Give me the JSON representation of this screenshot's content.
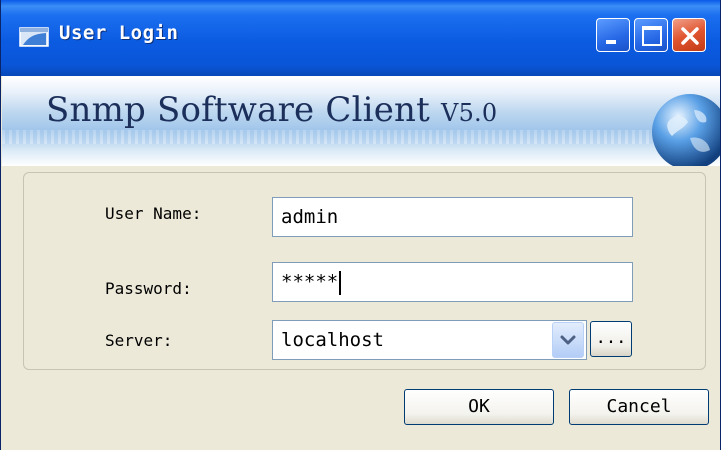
{
  "window": {
    "title": "User Login",
    "app_icon": "login-app-icon",
    "controls": {
      "minimize": "minimize-icon",
      "maximize": "maximize-icon",
      "close": "close-icon"
    }
  },
  "banner": {
    "title": "Snmp Software Client",
    "version": "V5.0",
    "graphic": "globe-icon"
  },
  "form": {
    "username": {
      "label": "User Name:",
      "value": "admin"
    },
    "password": {
      "label": "Password:",
      "value": "*****"
    },
    "server": {
      "label": "Server:",
      "value": "localhost",
      "dropdown_icon": "chevron-down-icon",
      "browse_label": "..."
    }
  },
  "buttons": {
    "ok": "OK",
    "cancel": "Cancel"
  },
  "colors": {
    "titlebar": "#0A5AE8",
    "dialog_bg": "#ECE9D8",
    "close_button": "#E0552F",
    "banner_text": "#1B2F5A"
  }
}
